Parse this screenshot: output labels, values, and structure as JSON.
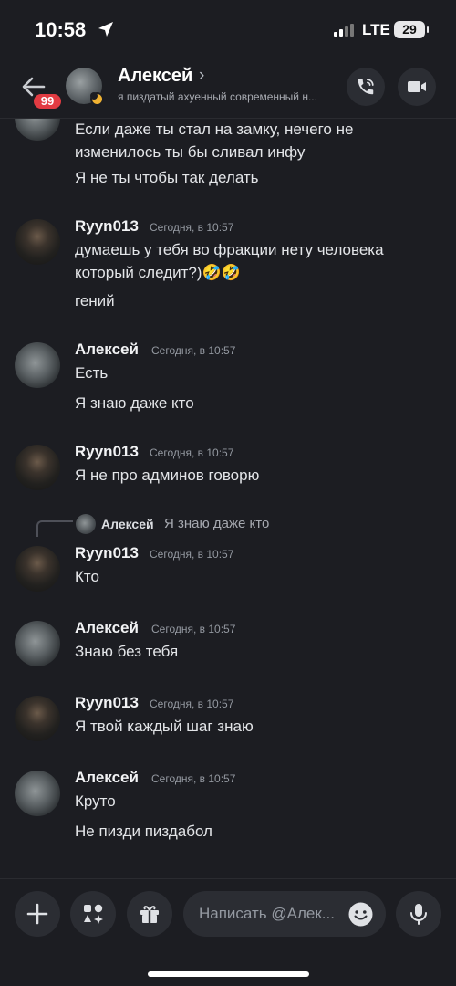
{
  "status_bar": {
    "time": "10:58",
    "network": "LTE",
    "battery": "29"
  },
  "header": {
    "back_badge": "99",
    "name": "Алексей",
    "chevron": "›",
    "status": "я пиздатый ахуенный современный н...",
    "icons": [
      "back-arrow-icon",
      "phone-call-icon",
      "video-camera-icon",
      "moon-icon"
    ]
  },
  "messages": [
    {
      "author": "",
      "time": "",
      "lines": [
        "Если даже ты стал на замку, нечего не изменилось ты бы сливал инфу",
        "Я не ты чтобы так делать"
      ]
    },
    {
      "author": "Ryyn013",
      "time": "Сегодня, в 10:57",
      "lines": [
        "думаешь у тебя во фракции нету человека который следит?)🤣🤣",
        "гений"
      ]
    },
    {
      "author": "Алексей",
      "time": "Сегодня, в 10:57",
      "lines": [
        "Есть",
        "Я знаю даже кто"
      ]
    },
    {
      "author": "Ryyn013",
      "time": "Сегодня, в 10:57",
      "lines": [
        "Я не про админов говорю"
      ]
    },
    {
      "author": "Ryyn013",
      "time": "Сегодня, в 10:57",
      "lines": [
        "Кто"
      ],
      "reply": {
        "author": "Алексей",
        "text": "Я знаю даже кто"
      }
    },
    {
      "author": "Алексей",
      "time": "Сегодня, в 10:57",
      "lines": [
        "Знаю без тебя"
      ]
    },
    {
      "author": "Ryyn013",
      "time": "Сегодня, в 10:57",
      "lines": [
        "Я твой каждый шаг знаю"
      ]
    },
    {
      "author": "Алексей",
      "time": "Сегодня, в 10:57",
      "lines": [
        "Круто",
        "Не пизди пиздабол"
      ]
    }
  ],
  "composer": {
    "placeholder": "Написать @Алек...",
    "icons": [
      "plus-icon",
      "apps-icon",
      "gift-icon",
      "emoji-icon",
      "microphone-icon"
    ]
  }
}
